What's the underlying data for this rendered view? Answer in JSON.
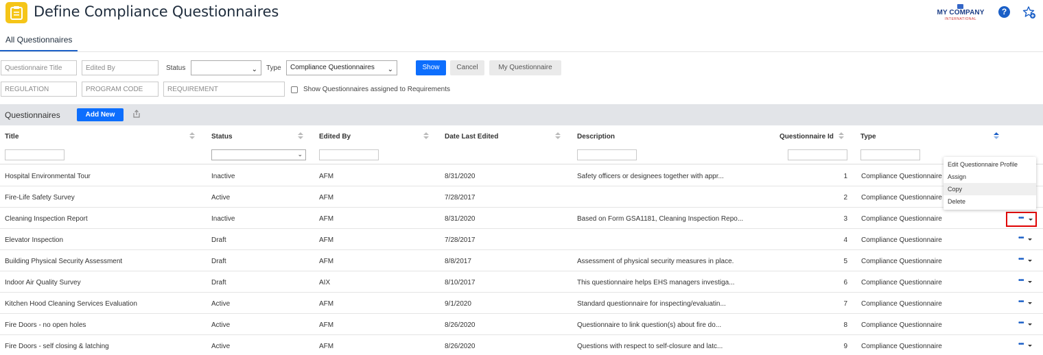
{
  "header": {
    "title": "Define Compliance Questionnaires",
    "logo_main": "MY COMPANY",
    "logo_sub": "INTERNATIONAL",
    "help_icon": "help-circle-icon",
    "favorite_icon": "star-plus-icon",
    "app_icon": "clipboard-icon",
    "colors": {
      "app_icon_bg": "#f5c518",
      "accent": "#0d6efd"
    }
  },
  "tabs": [
    {
      "label": "All Questionnaires",
      "active": true
    }
  ],
  "filters": {
    "title_placeholder": "Questionnaire Title",
    "edited_by_placeholder": "Edited By",
    "status_label": "Status",
    "status_value": "",
    "type_label": "Type",
    "type_value": "Compliance Questionnaires",
    "show_label": "Show",
    "cancel_label": "Cancel",
    "my_questionnaire_label": "My Questionnaire",
    "regulation_placeholder": "REGULATION",
    "program_code_placeholder": "PROGRAM CODE",
    "requirement_placeholder": "REQUIREMENT",
    "show_assigned_label": "Show Questionnaires assigned to Requirements",
    "show_assigned_checked": false
  },
  "panel": {
    "title": "Questionnaires",
    "add_new_label": "Add New",
    "export_icon": "export-icon"
  },
  "table": {
    "columns": [
      "Title",
      "Status",
      "Edited By",
      "Date Last Edited",
      "Description",
      "Questionnaire Id",
      "Type"
    ],
    "rows": [
      {
        "title": "Hospital Environmental Tour",
        "status": "Inactive",
        "edited_by": "AFM",
        "date": "8/31/2020",
        "description": "Safety officers or designees together with appr...",
        "id": "1",
        "type": "Compliance Questionnaire"
      },
      {
        "title": "Fire-Life Safety Survey",
        "status": "Active",
        "edited_by": "AFM",
        "date": "7/28/2017",
        "description": "",
        "id": "2",
        "type": "Compliance Questionnaire"
      },
      {
        "title": "Cleaning Inspection Report",
        "status": "Inactive",
        "edited_by": "AFM",
        "date": "8/31/2020",
        "description": "Based on Form GSA1181, Cleaning Inspection Repo...",
        "id": "3",
        "type": "Compliance Questionnaire"
      },
      {
        "title": "Elevator Inspection",
        "status": "Draft",
        "edited_by": "AFM",
        "date": "7/28/2017",
        "description": "",
        "id": "4",
        "type": "Compliance Questionnaire"
      },
      {
        "title": "Building Physical Security Assessment",
        "status": "Draft",
        "edited_by": "AFM",
        "date": "8/8/2017",
        "description": "Assessment of physical security measures in place.",
        "id": "5",
        "type": "Compliance Questionnaire"
      },
      {
        "title": "Indoor Air Quality Survey",
        "status": "Draft",
        "edited_by": "AIX",
        "date": "8/10/2017",
        "description": "This questionnaire helps EHS managers investiga...",
        "id": "6",
        "type": "Compliance Questionnaire"
      },
      {
        "title": "Kitchen Hood Cleaning Services Evaluation",
        "status": "Active",
        "edited_by": "AFM",
        "date": "9/1/2020",
        "description": "Standard questionnaire for inspecting/evaluatin...",
        "id": "7",
        "type": "Compliance Questionnaire"
      },
      {
        "title": "Fire Doors - no open holes",
        "status": "Active",
        "edited_by": "AFM",
        "date": "8/26/2020",
        "description": "Questionnaire to link question(s) about fire do...",
        "id": "8",
        "type": "Compliance Questionnaire"
      },
      {
        "title": "Fire Doors - self closing & latching",
        "status": "Active",
        "edited_by": "AFM",
        "date": "8/26/2020",
        "description": "Questions with respect to self-closure and latc...",
        "id": "9",
        "type": "Compliance Questionnaire"
      }
    ],
    "row_action_icon": "more-actions-icon"
  },
  "context_menu": {
    "items": [
      "Edit Questionnaire Profile",
      "Assign",
      "Copy",
      "Delete"
    ],
    "hovered": "Copy"
  }
}
